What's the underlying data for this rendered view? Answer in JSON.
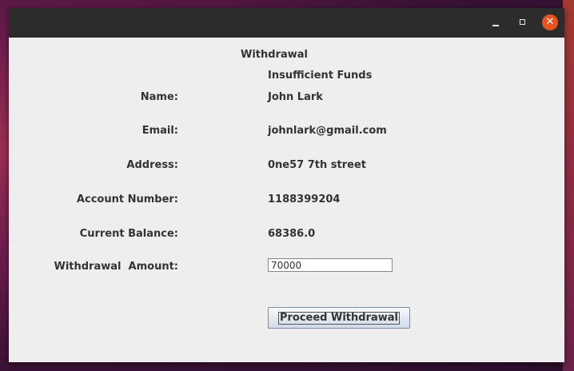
{
  "window": {
    "title": "",
    "controls": {
      "minimize_icon": "minimize-icon",
      "maximize_icon": "maximize-icon",
      "close_icon": "close-icon",
      "close_color": "#e95420"
    }
  },
  "form": {
    "heading": "Withdrawal",
    "status_message": "Insufficient Funds",
    "fields": {
      "name": {
        "label": "Name:",
        "value": "John Lark"
      },
      "email": {
        "label": "Email:",
        "value": "johnlark@gmail.com"
      },
      "address": {
        "label": "Address:",
        "value": "0ne57 7th street"
      },
      "account_number": {
        "label": "Account Number:",
        "value": "1188399204"
      },
      "current_balance": {
        "label": "Current Balance:",
        "value": "68386.0"
      },
      "withdrawal_amount": {
        "label": "Withdrawal  Amount:",
        "value": "70000"
      }
    },
    "proceed_label": "Proceed Withdrawal"
  }
}
